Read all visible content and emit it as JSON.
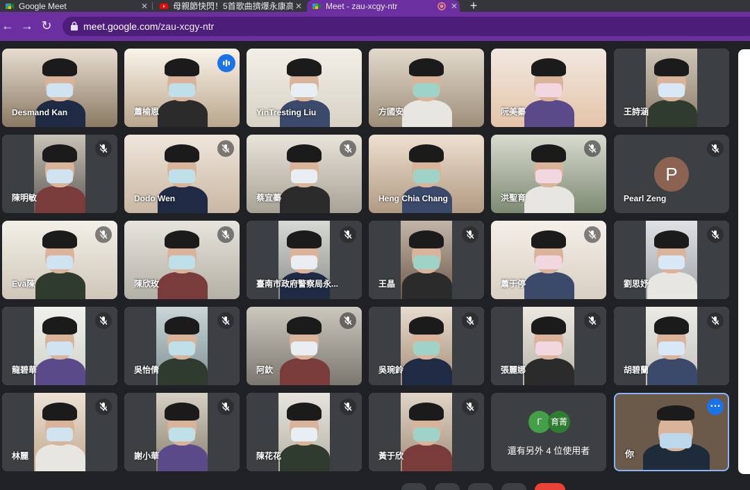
{
  "browser": {
    "tabs": [
      {
        "title": "Google Meet",
        "favicon": "meet-icon",
        "active": false
      },
      {
        "title": "母親節快閃！5首歌曲擠爆永康高",
        "favicon": "youtube-icon",
        "active": false
      },
      {
        "title": "Meet - zau-xcgy-ntr",
        "favicon": "meet-icon",
        "active": true
      }
    ],
    "url_host": "meet.google.com",
    "url_path": "/zau-xcgy-ntr",
    "theme_color": "#6c2fa0"
  },
  "participants": [
    {
      "name": "Desmand Kan",
      "muted": false,
      "speaking": false
    },
    {
      "name": "蕭榆恩",
      "muted": false,
      "speaking": true
    },
    {
      "name": "YinTresting Liu",
      "muted": false,
      "speaking": false
    },
    {
      "name": "方國安",
      "muted": false,
      "speaking": false
    },
    {
      "name": "阮美蓁",
      "muted": false,
      "speaking": false
    },
    {
      "name": "王詩涵",
      "muted": false,
      "speaking": false
    },
    {
      "name": "陳明敏",
      "muted": true
    },
    {
      "name": "Dodo Wen",
      "muted": true
    },
    {
      "name": "蔡宜蓁",
      "muted": true
    },
    {
      "name": "Heng Chia Chang",
      "muted": false
    },
    {
      "name": "洪聖育",
      "muted": true
    },
    {
      "name": "Pearl Zeng",
      "muted": true,
      "avatar_letter": "P"
    },
    {
      "name": "Eva陳",
      "muted": true
    },
    {
      "name": "陳欣玫",
      "muted": true
    },
    {
      "name": "臺南市政府警察局永...",
      "muted": true
    },
    {
      "name": "王晶",
      "muted": true
    },
    {
      "name": "蕭于停",
      "muted": true
    },
    {
      "name": "劉思妤",
      "muted": true
    },
    {
      "name": "龍碧華",
      "muted": true
    },
    {
      "name": "吳怡倩",
      "muted": true
    },
    {
      "name": "阿欽",
      "muted": true
    },
    {
      "name": "吳琬鈴",
      "muted": true
    },
    {
      "name": "張麗娜",
      "muted": true
    },
    {
      "name": "胡碧蘭",
      "muted": true
    },
    {
      "name": "林麗",
      "muted": true
    },
    {
      "name": "謝小華",
      "muted": true
    },
    {
      "name": "陳花花",
      "muted": true
    },
    {
      "name": "黃于欣",
      "muted": true
    }
  ],
  "others": {
    "chips": [
      "Γ",
      "育菁"
    ],
    "label": "還有另外 4 位使用者"
  },
  "self": {
    "name": "你"
  }
}
